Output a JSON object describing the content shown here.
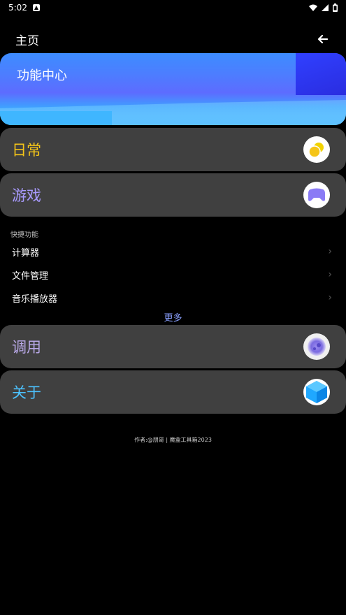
{
  "status_bar": {
    "time": "5:02"
  },
  "app_bar": {
    "title": "主页"
  },
  "banner": {
    "title": "功能中心"
  },
  "cards": [
    {
      "label": "日常",
      "color": "#f5c518",
      "icon": "coins-icon"
    },
    {
      "label": "游戏",
      "color": "#a99bff",
      "icon": "gamepad-icon"
    },
    {
      "label": "调用",
      "color": "#b8a8e6",
      "icon": "orb-icon"
    },
    {
      "label": "关于",
      "color": "#4cc2ff",
      "icon": "cube-icon"
    }
  ],
  "quick": {
    "section_label": "快捷功能",
    "items": [
      {
        "label": "计算器"
      },
      {
        "label": "文件管理"
      },
      {
        "label": "音乐播放器"
      }
    ],
    "more_label": "更多"
  },
  "footer": {
    "text": "作者:@朋哥 | 魔盒工具箱2023"
  }
}
